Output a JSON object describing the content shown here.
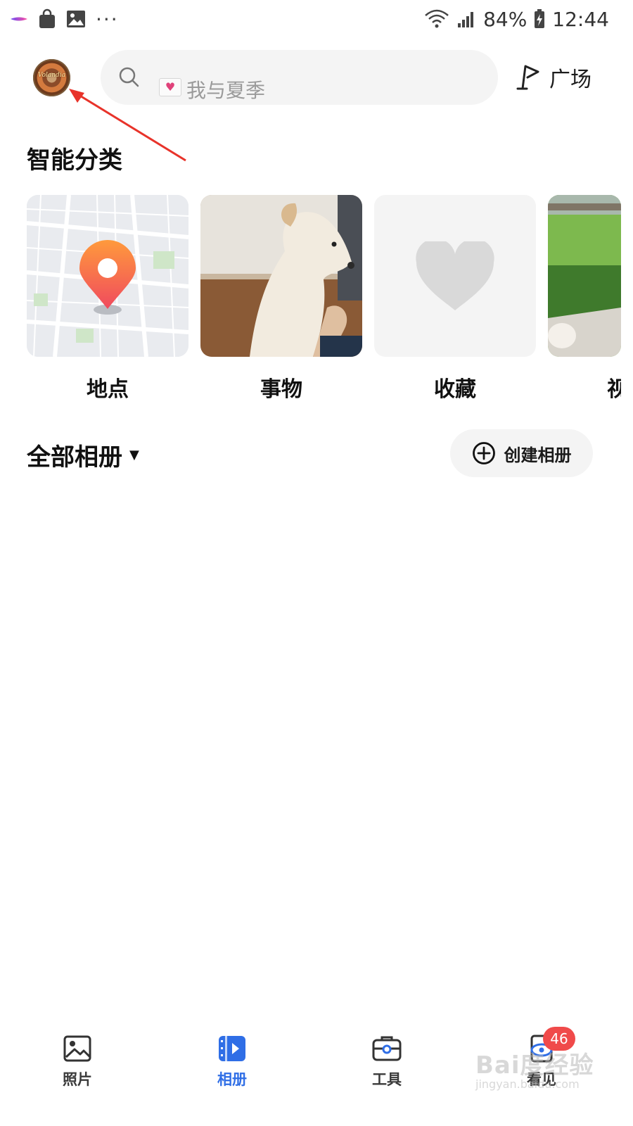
{
  "status_bar": {
    "battery": "84%",
    "time": "12:44",
    "more": "···"
  },
  "header": {
    "avatar_text": "Volandia",
    "search_placeholder": "我与夏季",
    "plaza_label": "广场"
  },
  "smart_categories": {
    "title": "智能分类",
    "items": [
      {
        "label": "地点",
        "icon": "location-pin-icon"
      },
      {
        "label": "事物",
        "icon": "dog-photo"
      },
      {
        "label": "收藏",
        "icon": "heart-icon"
      },
      {
        "label": "视",
        "icon": "video-photo"
      }
    ]
  },
  "albums": {
    "title": "全部相册",
    "create_label": "创建相册"
  },
  "bottom_nav": {
    "items": [
      {
        "label": "照片",
        "icon": "image-icon",
        "active": false
      },
      {
        "label": "相册",
        "icon": "album-icon",
        "active": true
      },
      {
        "label": "工具",
        "icon": "toolbox-icon",
        "active": false
      },
      {
        "label": "看见",
        "icon": "eye-icon",
        "active": false,
        "badge": "46"
      }
    ]
  },
  "watermark": {
    "main": "Bai度经验",
    "sub": "jingyan.baidu.com"
  },
  "colors": {
    "accent": "#2f6ee6",
    "badge": "#f04a4a",
    "pin": "#f25e5e",
    "annotation_arrow": "#e8332a"
  }
}
